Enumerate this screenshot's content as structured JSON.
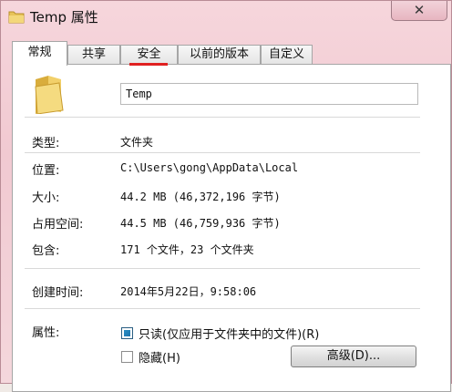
{
  "window": {
    "title": "Temp 属性",
    "close_label": "✕",
    "folder_icon": "folder-icon"
  },
  "tabs": [
    {
      "label": "常规",
      "active": true
    },
    {
      "label": "共享",
      "active": false
    },
    {
      "label": "安全",
      "active": false,
      "highlighted": true
    },
    {
      "label": "以前的版本",
      "active": false
    },
    {
      "label": "自定义",
      "active": false
    }
  ],
  "general": {
    "name_value": "Temp",
    "rows": [
      {
        "label": "类型:",
        "value": "文件夹"
      },
      {
        "label": "位置:",
        "value": "C:\\Users\\gong\\AppData\\Local"
      },
      {
        "label": "大小:",
        "value": "44.2 MB (46,372,196 字节)"
      },
      {
        "label": "占用空间:",
        "value": "44.5 MB (46,759,936 字节)"
      },
      {
        "label": "包含:",
        "value": "171 个文件，23 个文件夹"
      }
    ],
    "created": {
      "label": "创建时间:",
      "value": "2014年5月22日，9:58:06"
    },
    "attributes": {
      "label": "属性:",
      "readonly": {
        "label": "只读(仅应用于文件夹中的文件)(R)",
        "checked": true
      },
      "hidden": {
        "label": "隐藏(H)",
        "checked": false
      },
      "advanced_button": "高级(D)..."
    }
  },
  "colors": {
    "frame": "#f1c9d1",
    "tab_highlight": "#e02020",
    "checkbox_checked": "#1a6fa8"
  }
}
